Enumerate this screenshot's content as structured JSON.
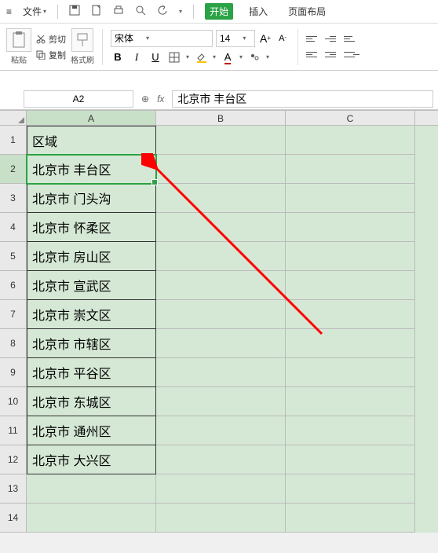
{
  "menu": {
    "file": "文件",
    "tab_start": "开始",
    "tab_insert": "插入",
    "tab_page": "页面布局"
  },
  "clip": {
    "paste": "粘贴",
    "cut": "剪切",
    "copy": "复制",
    "painter": "格式刷"
  },
  "font": {
    "name": "宋体",
    "size": "14"
  },
  "cellref": "A2",
  "fxvalue": "北京市  丰台区",
  "cols": {
    "A": "A",
    "B": "B",
    "C": "C"
  },
  "rows": [
    {
      "n": "1",
      "a": "区域"
    },
    {
      "n": "2",
      "a": "北京市  丰台区"
    },
    {
      "n": "3",
      "a": "北京市  门头沟"
    },
    {
      "n": "4",
      "a": "北京市  怀柔区"
    },
    {
      "n": "5",
      "a": "北京市  房山区"
    },
    {
      "n": "6",
      "a": "北京市  宣武区"
    },
    {
      "n": "7",
      "a": "北京市  崇文区"
    },
    {
      "n": "8",
      "a": "北京市  市辖区"
    },
    {
      "n": "9",
      "a": "北京市  平谷区"
    },
    {
      "n": "10",
      "a": "北京市  东城区"
    },
    {
      "n": "11",
      "a": "北京市  通州区"
    },
    {
      "n": "12",
      "a": "北京市  大兴区"
    },
    {
      "n": "13",
      "a": ""
    },
    {
      "n": "14",
      "a": ""
    }
  ],
  "chart_data": null
}
